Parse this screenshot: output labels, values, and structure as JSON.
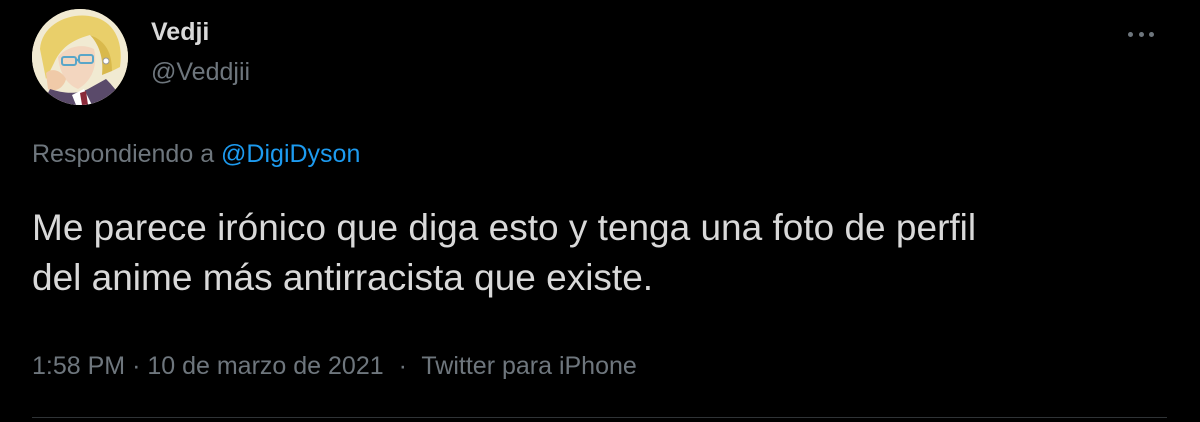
{
  "tweet": {
    "display_name": "Vedji",
    "handle": "@Veddjii",
    "replying_prefix": "Respondiendo a ",
    "replying_mention": "@DigiDyson",
    "text_line1": "Me parece irónico que diga esto y tenga una foto de perfil",
    "text_line2": "del anime más antirracista que existe.",
    "time": "1:58 PM",
    "dot1": "·",
    "date": "10 de marzo de 2021",
    "dot2": "·",
    "source": "Twitter para iPhone"
  },
  "icons": {
    "more": "more-horizontal-icon",
    "avatar": "anime-character-avatar"
  },
  "colors": {
    "background": "#000000",
    "text_primary": "#d9d9d9",
    "text_secondary": "#6e767d",
    "link": "#1d9bf0",
    "divider": "#2f3336"
  }
}
